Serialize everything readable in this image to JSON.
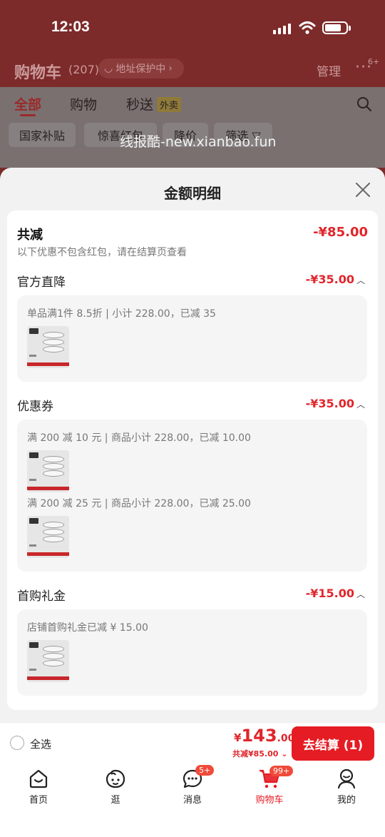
{
  "status_bar": {
    "time": "12:03"
  },
  "header": {
    "title": "购物车",
    "count": "(207)",
    "address_label": "地址保护中",
    "manage_label": "管理",
    "more_badge": "6+"
  },
  "tabs": [
    {
      "label": "全部"
    },
    {
      "label": "购物"
    },
    {
      "label": "秒送"
    }
  ],
  "waimai_tag": "外卖",
  "chips": [
    "国家补贴",
    "惊喜红包",
    "降价",
    "筛选 ▽"
  ],
  "watermark": "线报酷-new.xianbao.fun",
  "sheet": {
    "title": "金额明细",
    "total": {
      "label": "共减",
      "amount": "-¥85.00",
      "note": "以下优惠不包含红包，请在结算页查看"
    },
    "sections": [
      {
        "title": "官方直降",
        "amount": "-¥35.00",
        "lines": [
          "单品满1件 8.5折 | 小计 228.00，已减 35"
        ]
      },
      {
        "title": "优惠券",
        "amount": "-¥35.00",
        "lines": [
          "满 200 减 10 元 | 商品小计 228.00，已减 10.00",
          "满 200 减 25 元 | 商品小计 228.00，已减 25.00"
        ]
      },
      {
        "title": "首购礼金",
        "amount": "-¥15.00",
        "lines": [
          "店铺首购礼金已减 ¥ 15.00"
        ]
      }
    ]
  },
  "checkout": {
    "select_all": "全选",
    "price_symbol": "¥",
    "price_int": "143",
    "price_dec": ".00",
    "saved": "共减¥85.00",
    "pay_button": "去结算 (1)"
  },
  "tabbar": [
    {
      "label": "首页",
      "icon": "home-icon"
    },
    {
      "label": "逛",
      "icon": "browse-face-icon"
    },
    {
      "label": "消息",
      "icon": "message-icon",
      "badge": "5+"
    },
    {
      "label": "购物车",
      "icon": "cart-icon",
      "badge": "99+",
      "active": true
    },
    {
      "label": "我的",
      "icon": "profile-icon"
    }
  ],
  "colors": {
    "accent": "#e51c23",
    "price_red": "#e0262b",
    "sheet_bg": "#f2f2f2"
  }
}
